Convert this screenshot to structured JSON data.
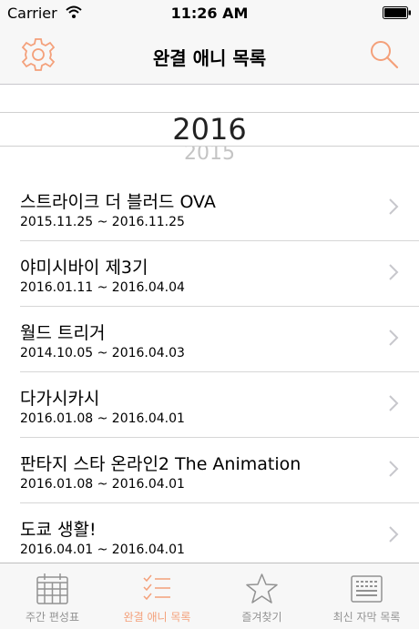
{
  "status": {
    "carrier": "Carrier",
    "time": "11:26 AM"
  },
  "nav": {
    "title": "완결 애니 목록"
  },
  "picker": {
    "selected_year": "2016",
    "next_year": "2015"
  },
  "accent_color": "#f4a07a",
  "items": [
    {
      "name": "스트라이크 더 블러드 OVA",
      "dates": "2015.11.25 ~ 2016.11.25"
    },
    {
      "name": "야미시바이 제3기",
      "dates": "2016.01.11 ~ 2016.04.04"
    },
    {
      "name": "월드 트리거",
      "dates": "2014.10.05 ~ 2016.04.03"
    },
    {
      "name": "다가시카시",
      "dates": "2016.01.08 ~ 2016.04.01"
    },
    {
      "name": "판타지 스타 온라인2 The Animation",
      "dates": "2016.01.08 ~ 2016.04.01"
    },
    {
      "name": "도쿄 생활!",
      "dates": "2016.04.01 ~ 2016.04.01"
    }
  ],
  "tabs": [
    {
      "label": "주간 편성표",
      "icon": "calendar-icon",
      "active": false
    },
    {
      "label": "완결 애니 목록",
      "icon": "checklist-icon",
      "active": true
    },
    {
      "label": "즐겨찾기",
      "icon": "star-icon",
      "active": false
    },
    {
      "label": "최신 자막 목록",
      "icon": "subtitle-icon",
      "active": false
    }
  ]
}
